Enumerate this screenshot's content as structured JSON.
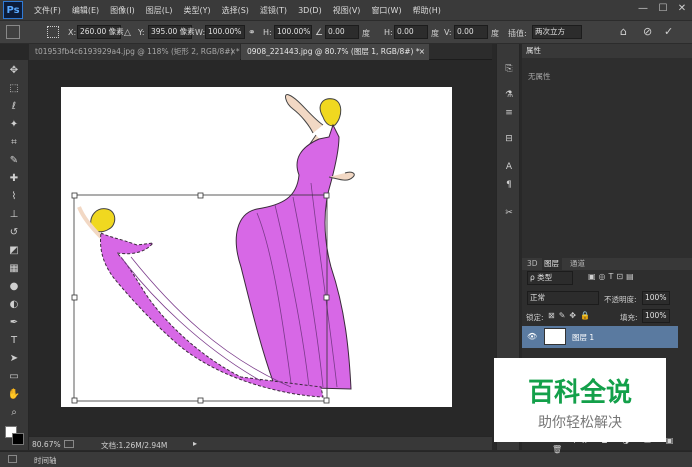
{
  "app": {
    "logo": "Ps"
  },
  "menu": {
    "items": [
      "文件(F)",
      "编辑(E)",
      "图像(I)",
      "图层(L)",
      "类型(Y)",
      "选择(S)",
      "滤镜(T)",
      "3D(D)",
      "视图(V)",
      "窗口(W)",
      "帮助(H)"
    ]
  },
  "window_controls": {
    "minimize": "—",
    "maximize": "☐",
    "close": "✕"
  },
  "options_bar": {
    "x_label": "X:",
    "x_value": "260.00 像素",
    "y_label": "Y:",
    "y_value": "395.00 像素",
    "w_label": "W:",
    "w_value": "100.00%",
    "h_label": "H:",
    "h_value": "100.00%",
    "angle_value": "0.00",
    "angle_unit": "度",
    "hskew_label": "H:",
    "hskew_value": "0.00",
    "hskew_unit": "度",
    "vskew_label": "V:",
    "vskew_value": "0.00",
    "vskew_unit": "度",
    "interp_label": "插值:",
    "interp_value": "两次立方"
  },
  "tabs": [
    {
      "label": "t01953fb4c6193929a4.jpg @ 118% (矩形 2, RGB/8#) *",
      "close": "×"
    },
    {
      "label": "0908_221443.jpg @ 80.7% (图层 1, RGB/8#) *",
      "close": "×"
    }
  ],
  "status": {
    "zoom": "80.67%",
    "doc_info": "文档:1.26M/2.94M"
  },
  "timeline": {
    "label": "时间轴"
  },
  "properties": {
    "tab": "属性",
    "empty_text": "无属性"
  },
  "layers_panel": {
    "tabs": [
      "3D",
      "图层",
      "通道"
    ],
    "filter_value": "ρ 类型",
    "blend_mode": "正常",
    "opacity_label": "不透明度:",
    "opacity_value": "100%",
    "lock_label": "锁定:",
    "fill_label": "填充:",
    "fill_value": "100%",
    "layers": [
      {
        "name": "图层 1"
      }
    ]
  },
  "watermark": {
    "title": "百科全说",
    "subtitle": "助你轻松解决"
  },
  "colors": {
    "accent_blue": "#5a7aa0",
    "figure_fill": "#d768e6",
    "hair": "#f0d820"
  }
}
